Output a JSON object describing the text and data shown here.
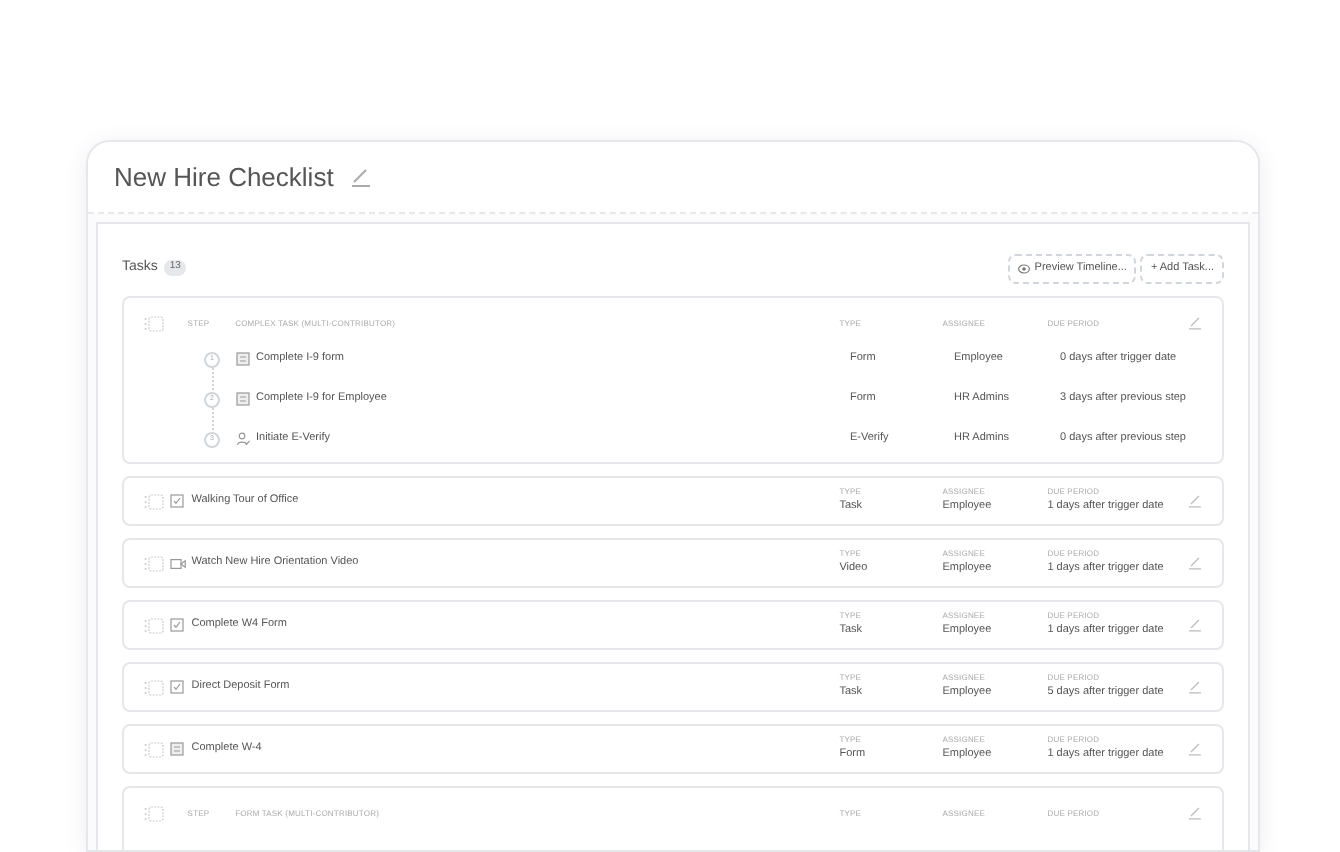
{
  "title": "New Hire Checklist",
  "tasks_header": {
    "label": "Tasks",
    "count": "13"
  },
  "buttons": [
    {
      "label": "Preview Timeline..."
    },
    {
      "label": "+ Add Task..."
    }
  ],
  "items": [
    {
      "kind": "group",
      "step_label": "STEP",
      "heading": "COMPLEX TASK (MULTI-CONTRIBUTOR)",
      "labels": [
        "TYPE",
        "ASSIGNEE",
        "DUE PERIOD"
      ],
      "steps": [
        {
          "kind": "form",
          "number": "1",
          "name": "Complete I-9 form",
          "type": "Form",
          "assignee": "Employee",
          "due": "0 days after trigger date"
        },
        {
          "kind": "form",
          "number": "2",
          "name": "Complete I-9 for Employee",
          "type": "Form",
          "assignee": "HR Admins",
          "due": "3 days after previous step"
        },
        {
          "kind": "verify",
          "number": "3",
          "name": "Initiate E-Verify",
          "type": "E-Verify",
          "assignee": "HR Admins",
          "due": "0 days after previous step"
        }
      ]
    },
    {
      "kind": "task",
      "name": "Walking Tour of Office",
      "labels": [
        "TYPE",
        "ASSIGNEE",
        "DUE PERIOD"
      ],
      "type": "Task",
      "assignee": "Employee",
      "due": "1 days after trigger date"
    },
    {
      "kind": "video",
      "name": "Watch New Hire Orientation Video",
      "labels": [
        "TYPE",
        "ASSIGNEE",
        "DUE PERIOD"
      ],
      "type": "Video",
      "assignee": "Employee",
      "due": "1 days after trigger date"
    },
    {
      "kind": "task",
      "name": "Complete W4 Form",
      "labels": [
        "TYPE",
        "ASSIGNEE",
        "DUE PERIOD"
      ],
      "type": "Task",
      "assignee": "Employee",
      "due": "1 days after trigger date"
    },
    {
      "kind": "task",
      "name": "Direct Deposit Form",
      "labels": [
        "TYPE",
        "ASSIGNEE",
        "DUE PERIOD"
      ],
      "type": "Task",
      "assignee": "Employee",
      "due": "5 days after trigger date"
    },
    {
      "kind": "form",
      "name": "Complete W-4",
      "labels": [
        "TYPE",
        "ASSIGNEE",
        "DUE PERIOD"
      ],
      "type": "Form",
      "assignee": "Employee",
      "due": "1 days after trigger date"
    },
    {
      "kind": "group",
      "step_label": "STEP",
      "heading": "FORM TASK (MULTI-CONTRIBUTOR)",
      "labels": [
        "TYPE",
        "ASSIGNEE",
        "DUE PERIOD"
      ]
    }
  ]
}
